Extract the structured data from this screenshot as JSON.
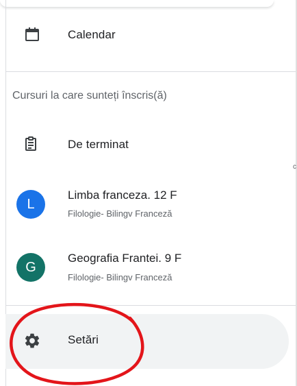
{
  "nav": {
    "calendar_label": "Calendar",
    "enrolled_section_title": "Cursuri la care sunteți înscris(ă)",
    "todo_label": "De terminat",
    "settings_label": "Setări"
  },
  "courses": [
    {
      "avatar_letter": "L",
      "title": "Limba franceza. 12 F",
      "subtitle": "Filologie- Bilingv Franceză",
      "color": "#1a73e8"
    },
    {
      "avatar_letter": "G",
      "title": "Geografia Frantei. 9 F",
      "subtitle": "Filologie- Bilingv Franceză",
      "color": "#137367"
    }
  ],
  "edge_mark": "c",
  "colors": {
    "annotation_circle": "#e3151a",
    "settings_highlight": "#f1f3f4"
  },
  "icons": [
    "calendar-icon",
    "assignment-icon",
    "gear-icon"
  ]
}
